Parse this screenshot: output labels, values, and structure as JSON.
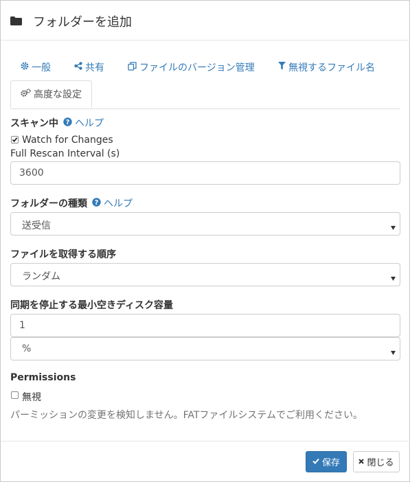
{
  "header": {
    "title": "フォルダーを追加",
    "icon": "folder-icon"
  },
  "tabs": [
    {
      "label": "一般",
      "icon": "gear-icon"
    },
    {
      "label": "共有",
      "icon": "share-icon"
    },
    {
      "label": "ファイルのバージョン管理",
      "icon": "copy-icon"
    },
    {
      "label": "無視するファイル名",
      "icon": "filter-icon"
    },
    {
      "label": "高度な設定",
      "icon": "gears-icon",
      "active": true
    }
  ],
  "scanning": {
    "label": "スキャン中",
    "help": "ヘルプ",
    "watch_label": "Watch for Changes",
    "watch_checked": true,
    "interval_label": "Full Rescan Interval (s)",
    "interval_value": "3600"
  },
  "folder_type": {
    "label": "フォルダーの種類",
    "help": "ヘルプ",
    "value": "送受信"
  },
  "pull_order": {
    "label": "ファイルを取得する順序",
    "value": "ランダム"
  },
  "min_disk": {
    "label": "同期を停止する最小空きディスク容量",
    "value": "1",
    "unit": "%"
  },
  "permissions": {
    "label": "Permissions",
    "ignore_label": "無視",
    "ignore_checked": false,
    "note": "パーミッションの変更を検知しません。FATファイルシステムでご利用ください。"
  },
  "footer": {
    "save_label": "保存",
    "close_label": "閉じる"
  },
  "colors": {
    "link": "#337ab7",
    "primary": "#337ab7"
  }
}
